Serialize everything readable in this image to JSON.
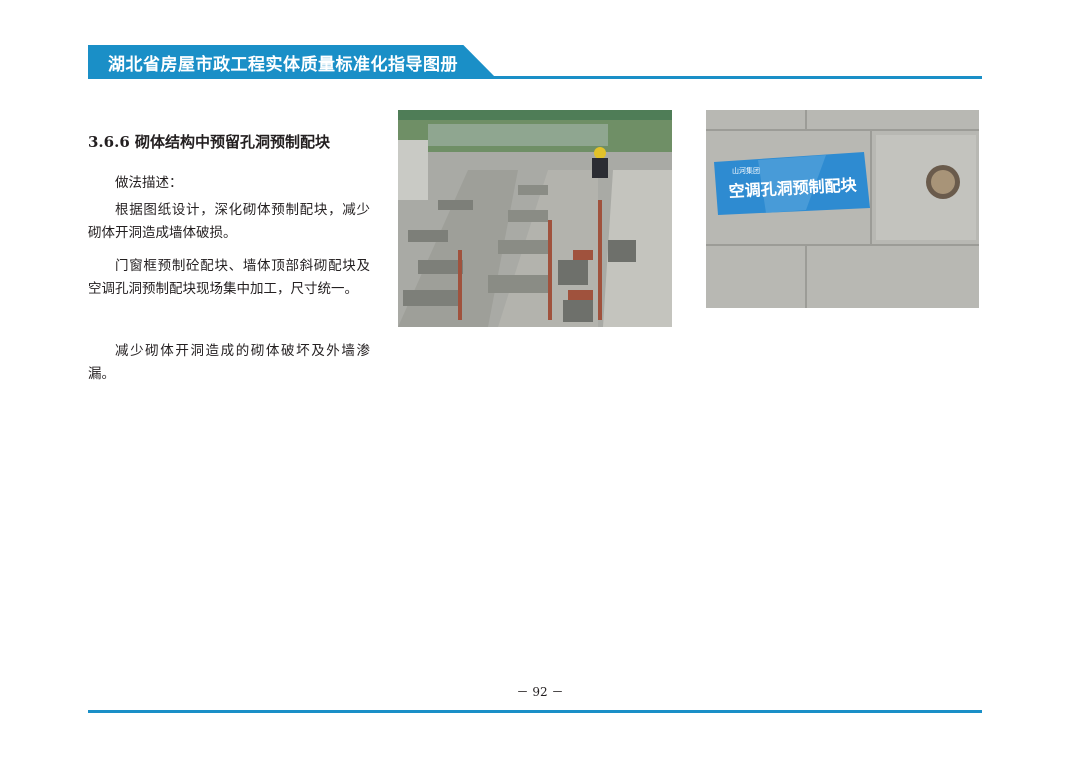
{
  "header": {
    "title": "湖北省房屋市政工程实体质量标准化指导图册",
    "accent_color": "#1a8fc7"
  },
  "section": {
    "title": "3.6.6   砌体结构中预留孔洞预制配块"
  },
  "body": {
    "paragraphs": [
      "做法描述：",
      "根据图纸设计，深化砌体预制配块，减少砌体开洞造成墙体破损。",
      "门窗框预制砼配块、墙体顶部斜砌配块及空调孔洞预制配块现场集中加工，尺寸统一。",
      "减少砌体开洞造成的砌体破坏及外墙渗漏。"
    ]
  },
  "photos": {
    "left": {
      "description_icon": "photo-precast-blocks-workshop"
    },
    "right": {
      "description_icon": "photo-aircon-hole-block",
      "sign_small_text": "山河集团",
      "sign_text": "空调孔洞预制配块"
    }
  },
  "footer": {
    "page_number": "－ 92 －"
  }
}
